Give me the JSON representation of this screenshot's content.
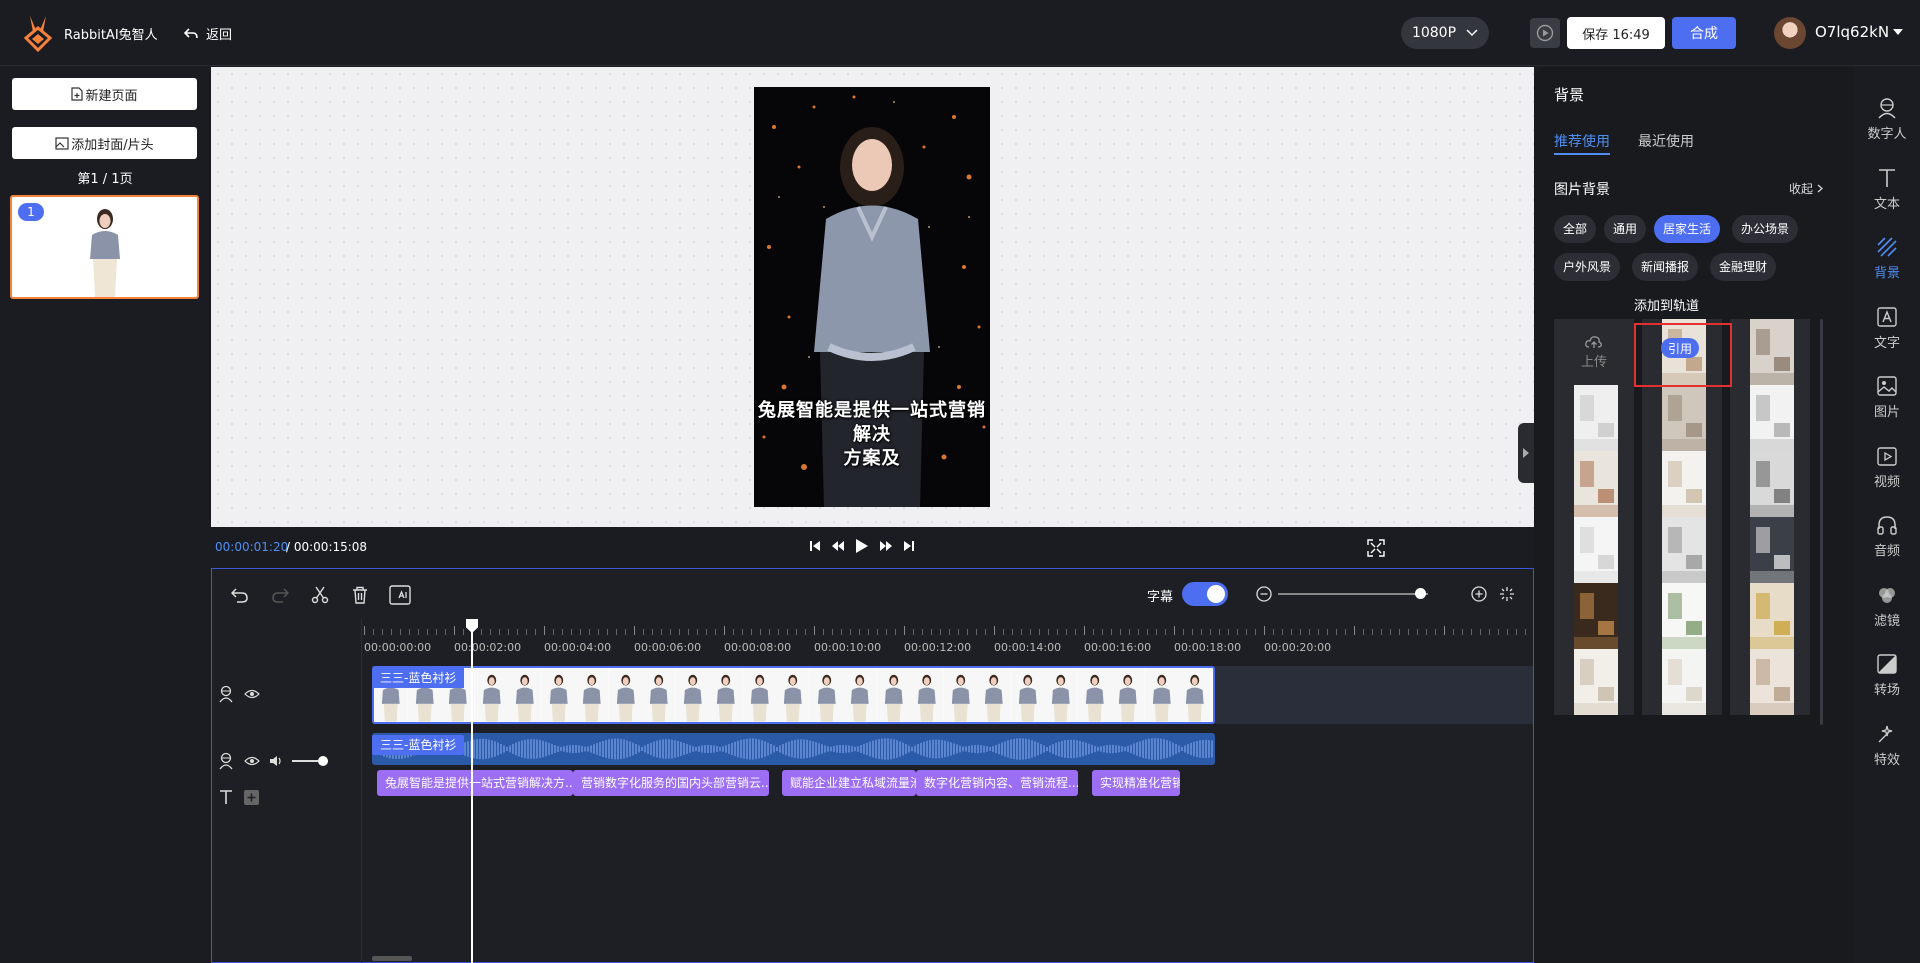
{
  "app": {
    "brand": "RabbitAI兔智人",
    "back": "返回"
  },
  "header": {
    "resolution": "1080P",
    "save_label": "保存 16:49",
    "compose_label": "合成",
    "username": "O7lq62kN"
  },
  "left": {
    "new_page": "新建页面",
    "add_cover": "添加封面/片头",
    "page_info": "第1 / 1页",
    "thumb_number": "1"
  },
  "canvas": {
    "caption_line1": "兔展智能是提供一站式营销解决",
    "caption_line2": "方案及"
  },
  "player": {
    "current": "00:00:01:20",
    "total": "/ 00:00:15:08"
  },
  "timeline": {
    "subtitle_label": "字幕",
    "subtitle_enabled": true,
    "ruler": [
      "00:00:00:00",
      "00:00:02:00",
      "00:00:04:00",
      "00:00:06:00",
      "00:00:08:00",
      "00:00:10:00",
      "00:00:12:00",
      "00:00:14:00",
      "00:00:16:00",
      "00:00:18:00",
      "00:00:20:00"
    ],
    "video_clip_label": "三三-蓝色衬衫",
    "audio_clip_label": "三三-蓝色衬衫",
    "subtitles": [
      "兔展智能是提供一站式营销解决方...",
      "营销数字化服务的国内头部营销云...",
      "赋能企业建立私域流量池",
      "数字化营销内容、营销流程...",
      "实现精准化营销"
    ]
  },
  "panel": {
    "title": "背景",
    "tabs": [
      "推荐使用",
      "最近使用"
    ],
    "section": "图片背景",
    "collapse": "收起",
    "chips": [
      "全部",
      "通用",
      "居家生活",
      "办公场景",
      "户外风景",
      "新闻播报",
      "金融理财"
    ],
    "active_chip": "居家生活",
    "tooltip": "添加到轨道",
    "upload": "上传",
    "quote": "引用"
  },
  "nav": [
    "数字人",
    "文本",
    "背景",
    "文字",
    "图片",
    "视频",
    "音频",
    "滤镜",
    "转场",
    "特效"
  ],
  "nav_active": "背景",
  "colors": {
    "accent": "#4e6ef2",
    "subtitle_clip": "#9b6ef3",
    "highlight": "#e53030",
    "logo": "#f5813a"
  }
}
